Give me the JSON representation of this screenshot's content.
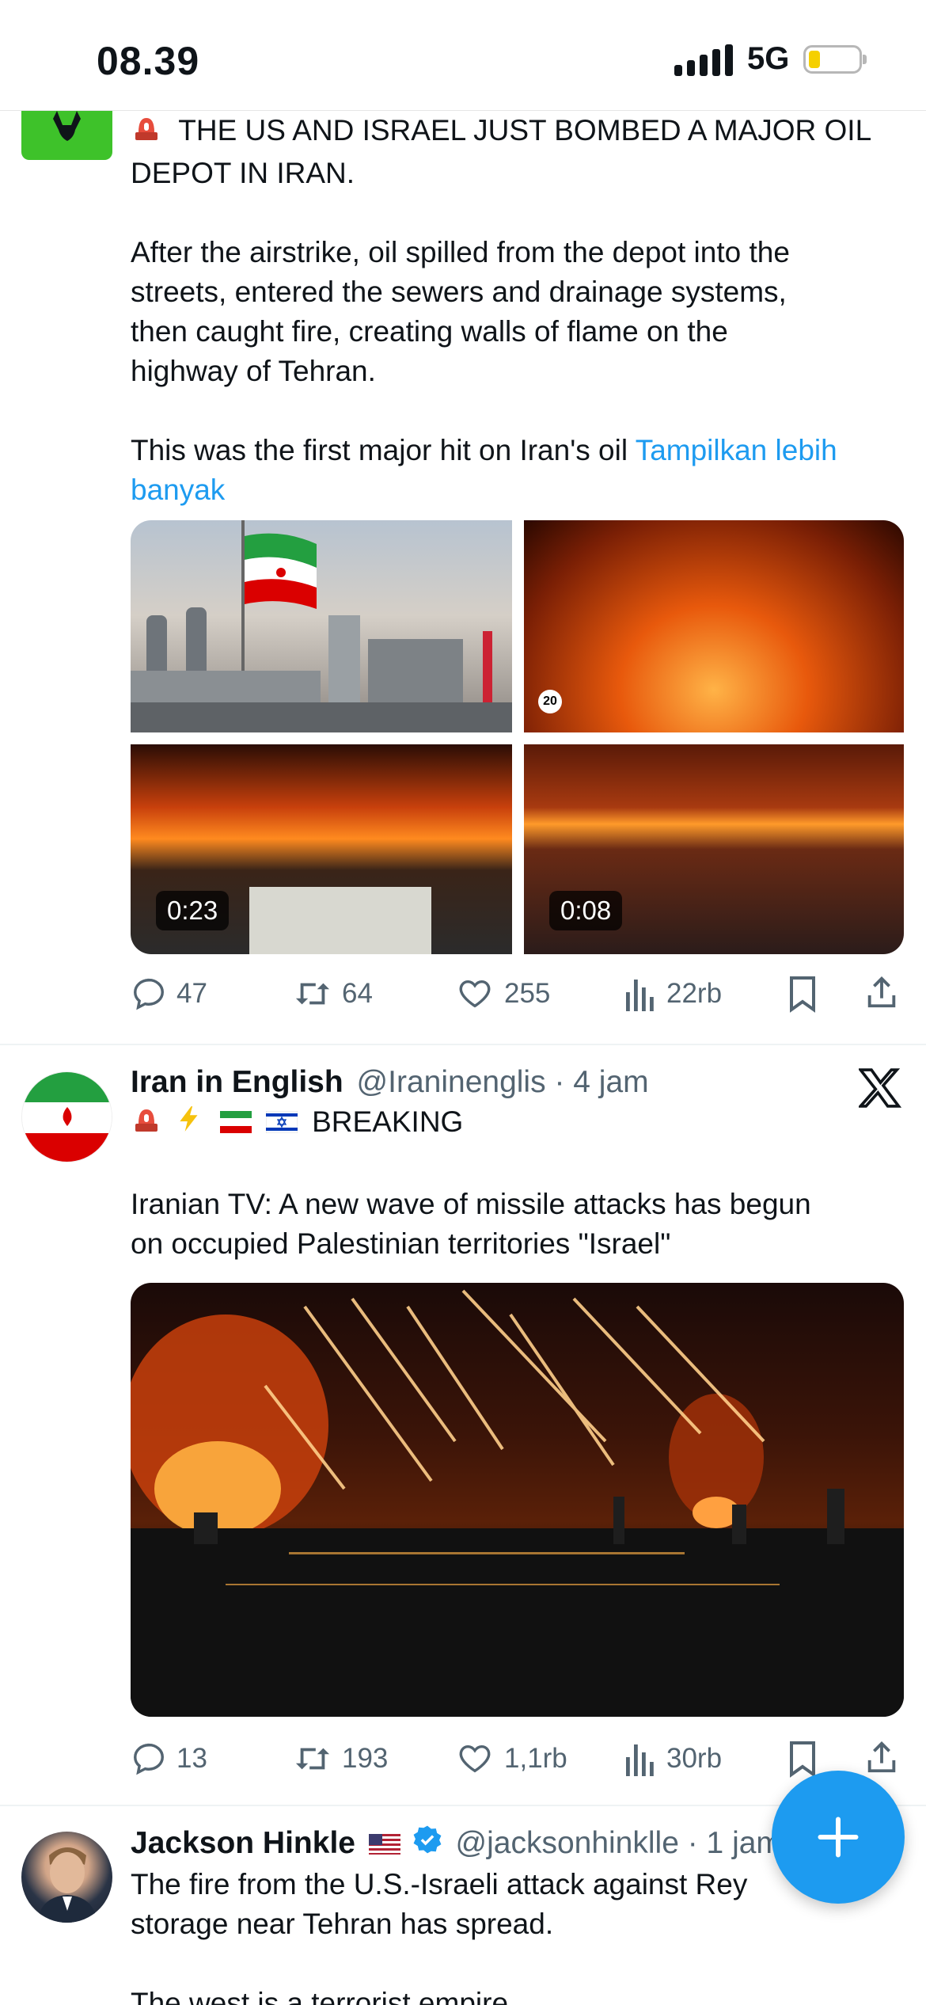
{
  "status_bar": {
    "time": "08.39",
    "network": "5G"
  },
  "tweets": [
    {
      "text_lines": [
        "THE US AND ISRAEL JUST BOMBED A MAJOR OIL",
        "DEPOT IN IRAN."
      ],
      "paragraph": [
        "After the airstrike, oil spilled from the depot into the",
        "streets, entered the sewers and drainage systems,",
        "then caught fire, creating walls of flame on the",
        "highway of Tehran."
      ],
      "last_line": "This was the first major hit on Iran's oil",
      "show_more": "Tampilkan lebih",
      "show_more_2": "banyak",
      "media": [
        {
          "type": "photo",
          "label": "20"
        },
        {
          "type": "photo"
        },
        {
          "type": "video",
          "duration": "0:23"
        },
        {
          "type": "video",
          "duration": "0:08"
        }
      ],
      "stats": {
        "replies": "47",
        "reposts": "64",
        "likes": "255",
        "views": "22rb"
      }
    },
    {
      "author": "Iran in English",
      "handle": "@Iraninenglis",
      "time": "· 4 jam",
      "heading": "BREAKING",
      "text_lines": [
        "Iranian TV: A new wave of missile attacks has begun",
        "on occupied Palestinian territories \"Israel\""
      ],
      "stats": {
        "replies": "13",
        "reposts": "193",
        "likes": "1,1rb",
        "views": "30rb"
      }
    },
    {
      "author": "Jackson Hinkle",
      "handle": "@jacksonhinklle",
      "time": "· 1 jam",
      "text_lines": [
        "The fire from the U.S.-Israeli attack against Rey",
        "storage near Tehran has spread."
      ],
      "partial_line": "The west is a terrorist empire"
    }
  ],
  "colors": {
    "accent": "#1d9bf0",
    "text": "#0f1419",
    "muted": "#536471"
  }
}
